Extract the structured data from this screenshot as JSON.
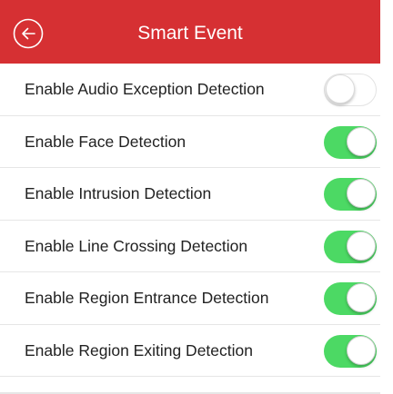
{
  "header": {
    "title": "Smart Event",
    "back_icon": "circle-left-arrow-icon",
    "background_color": "#d63033"
  },
  "settings": [
    {
      "label": "Enable Audio Exception Detection",
      "enabled": false
    },
    {
      "label": "Enable Face Detection",
      "enabled": true
    },
    {
      "label": "Enable Intrusion Detection",
      "enabled": true
    },
    {
      "label": "Enable Line Crossing Detection",
      "enabled": true
    },
    {
      "label": "Enable Region Entrance Detection",
      "enabled": true
    },
    {
      "label": "Enable Region Exiting Detection",
      "enabled": true
    }
  ],
  "colors": {
    "toggle_on": "#4cd964",
    "toggle_off": "#ffffff"
  }
}
